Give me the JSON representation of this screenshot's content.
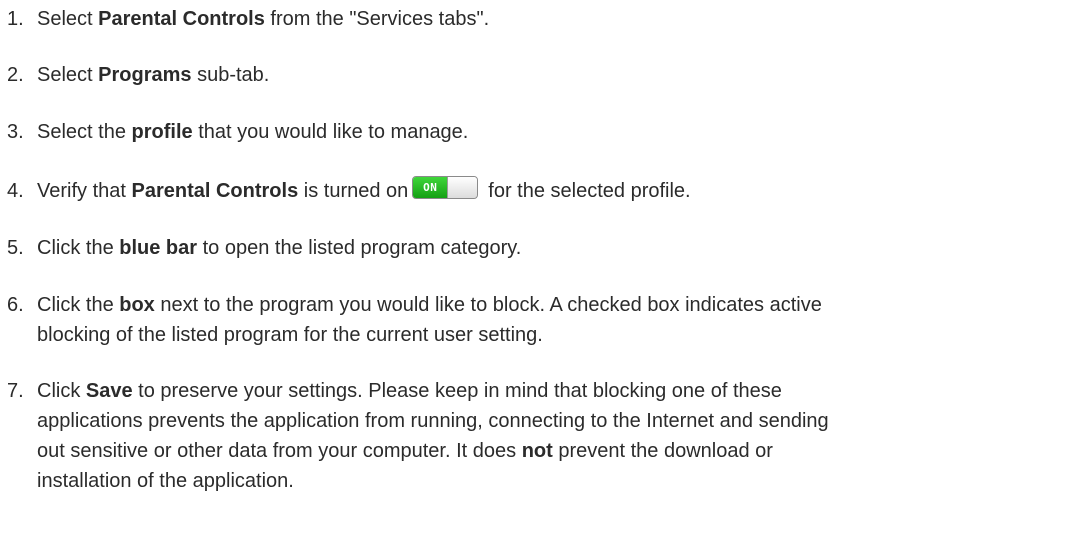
{
  "steps": [
    {
      "num": "1.",
      "pre": "Select ",
      "bold": "Parental Controls",
      "post": " from the \"Services tabs\"."
    },
    {
      "num": "2.",
      "pre": "Select ",
      "bold": "Programs",
      "post": " sub-tab."
    },
    {
      "num": "3.",
      "pre": "Select the ",
      "bold": "profile",
      "post": " that you would like to manage."
    },
    {
      "num": "4.",
      "pre": "Verify that ",
      "bold": "Parental Controls",
      "mid": " is turned on",
      "toggle_label": "ON",
      "post": "for the selected profile."
    },
    {
      "num": "5.",
      "pre": "Click the ",
      "bold": "blue bar",
      "post": " to open the listed program category."
    },
    {
      "num": "6.",
      "pre": "Click the ",
      "bold": "box",
      "post_line1": " next to the program you would like to block. A checked box indicates active",
      "line2": "blocking of the listed program for the current user setting."
    },
    {
      "num": "7.",
      "pre": "Click ",
      "bold": "Save",
      "post_line1": " to preserve your settings. Please keep in mind that blocking one of these",
      "line2": "applications prevents the application from running, connecting to the Internet and sending",
      "line3_pre": "out sensitive or other data from your computer. It does ",
      "line3_bold": "not",
      "line3_post": " prevent the download or",
      "line4": "installation of the application."
    }
  ],
  "colors": {
    "text": "#2b2b2b",
    "toggle_on": "#1fb01f"
  },
  "icons": {
    "toggle": "toggle-switch-on-icon"
  }
}
